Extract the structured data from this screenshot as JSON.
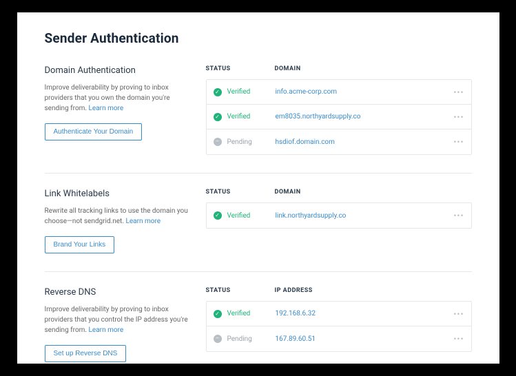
{
  "page_title": "Sender Authentication",
  "headers": {
    "status": "STATUS",
    "domain": "DOMAIN",
    "ip": "IP ADDRESS"
  },
  "status_labels": {
    "verified": "Verified",
    "pending": "Pending"
  },
  "learn_more": "Learn more",
  "sections": {
    "domain_auth": {
      "title": "Domain Authentication",
      "desc": "Improve deliverability by proving to inbox providers that you own the domain you're sending from.",
      "button": "Authenticate Your Domain",
      "rows": [
        {
          "status": "verified",
          "domain": "info.acme-corp.com"
        },
        {
          "status": "verified",
          "domain": "em8035.northyardsupply.co"
        },
        {
          "status": "pending",
          "domain": "hsdiof.domain.com"
        }
      ]
    },
    "link_whitelabels": {
      "title": "Link Whitelabels",
      "desc": "Rewrite all tracking links to use the domain you choose—not sendgrid.net.",
      "button": "Brand Your Links",
      "rows": [
        {
          "status": "verified",
          "domain": "link.northyardsupply.co"
        }
      ]
    },
    "reverse_dns": {
      "title": "Reverse DNS",
      "desc": "Improve deliverability by proving to inbox providers that you control the IP address you're sending from.",
      "button": "Set up Reverse DNS",
      "rows": [
        {
          "status": "verified",
          "ip": "192.168.6.32"
        },
        {
          "status": "pending",
          "ip": "167.89.60.51"
        }
      ]
    }
  }
}
